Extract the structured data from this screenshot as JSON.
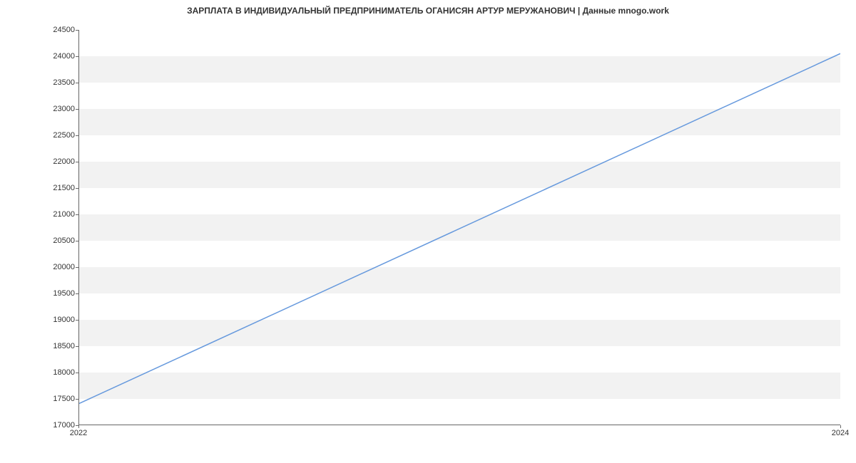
{
  "chart_data": {
    "type": "line",
    "title": "ЗАРПЛАТА В ИНДИВИДУАЛЬНЫЙ ПРЕДПРИНИМАТЕЛЬ ОГАНИСЯН АРТУР МЕРУЖАНОВИЧ | Данные mnogo.work",
    "x": [
      2022,
      2024
    ],
    "values": [
      17400,
      24050
    ],
    "xlabel": "",
    "ylabel": "",
    "xlim": [
      2022,
      2024
    ],
    "ylim": [
      17000,
      24500
    ],
    "y_ticks": [
      17000,
      17500,
      18000,
      18500,
      19000,
      19500,
      20000,
      20500,
      21000,
      21500,
      22000,
      22500,
      23000,
      23500,
      24000,
      24500
    ],
    "x_ticks": [
      2022,
      2024
    ],
    "grid": true,
    "line_color": "#6699dd"
  }
}
